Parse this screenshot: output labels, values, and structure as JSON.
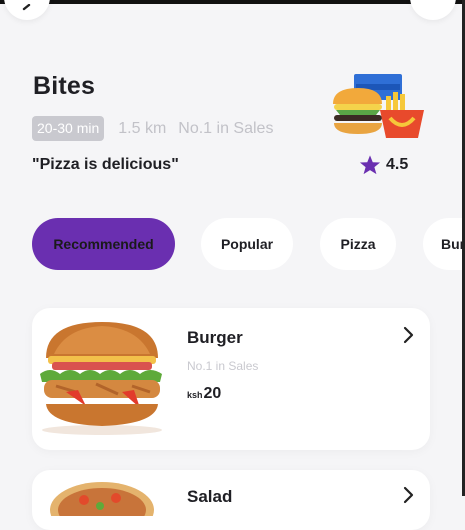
{
  "restaurant": {
    "name": "Bites",
    "time": "20-30 min",
    "distance": "1.5 km",
    "rank": "No.1 in Sales",
    "quote": "\"Pizza is delicious\"",
    "rating": "4.5"
  },
  "categories": [
    {
      "label": "Recommended",
      "active": true
    },
    {
      "label": "Popular",
      "active": false
    },
    {
      "label": "Pizza",
      "active": false
    },
    {
      "label": "Bur",
      "active": false
    }
  ],
  "items": [
    {
      "name": "Burger",
      "subtitle": "No.1 in Sales",
      "currency": "ksh",
      "price": "20",
      "image_icon": "burger-image"
    },
    {
      "name": "Salad",
      "image_icon": "salad-image"
    }
  ],
  "colors": {
    "accent": "#6a2fb0",
    "badge": "#c9c9cf",
    "background": "#f5f5f7",
    "card": "#ffffff"
  },
  "icons": {
    "back": "chevron-left-icon",
    "share": "share-icon",
    "star": "star-icon",
    "chevron": "chevron-right-icon",
    "logo": "fast-food-logo"
  }
}
